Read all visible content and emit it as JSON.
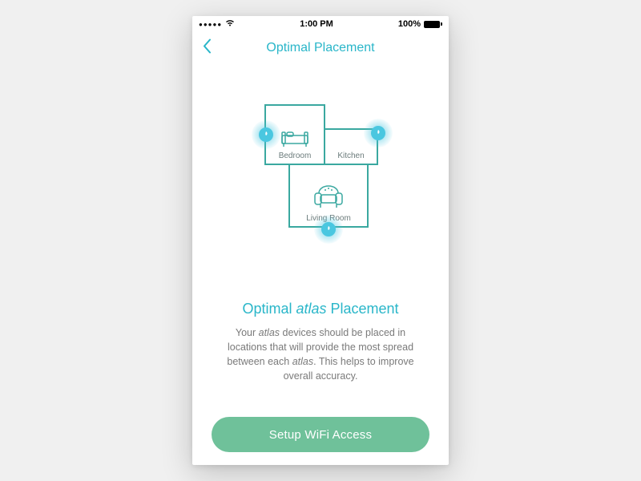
{
  "status": {
    "time": "1:00 PM",
    "battery": "100%"
  },
  "nav": {
    "title": "Optimal Placement"
  },
  "rooms": {
    "bedroom": "Bedroom",
    "kitchen": "Kitchen",
    "living": "Living Room"
  },
  "heading": {
    "pre": "Optimal ",
    "em": "atlas",
    "post": " Placement"
  },
  "body": {
    "p1a": "Your ",
    "p1em": "atlas",
    "p1b": " devices should be placed in locations that will provide the most spread between each ",
    "p1em2": "atlas",
    "p1c": ". This helps to improve overall accuracy."
  },
  "cta": {
    "label": "Setup WiFi Access"
  }
}
